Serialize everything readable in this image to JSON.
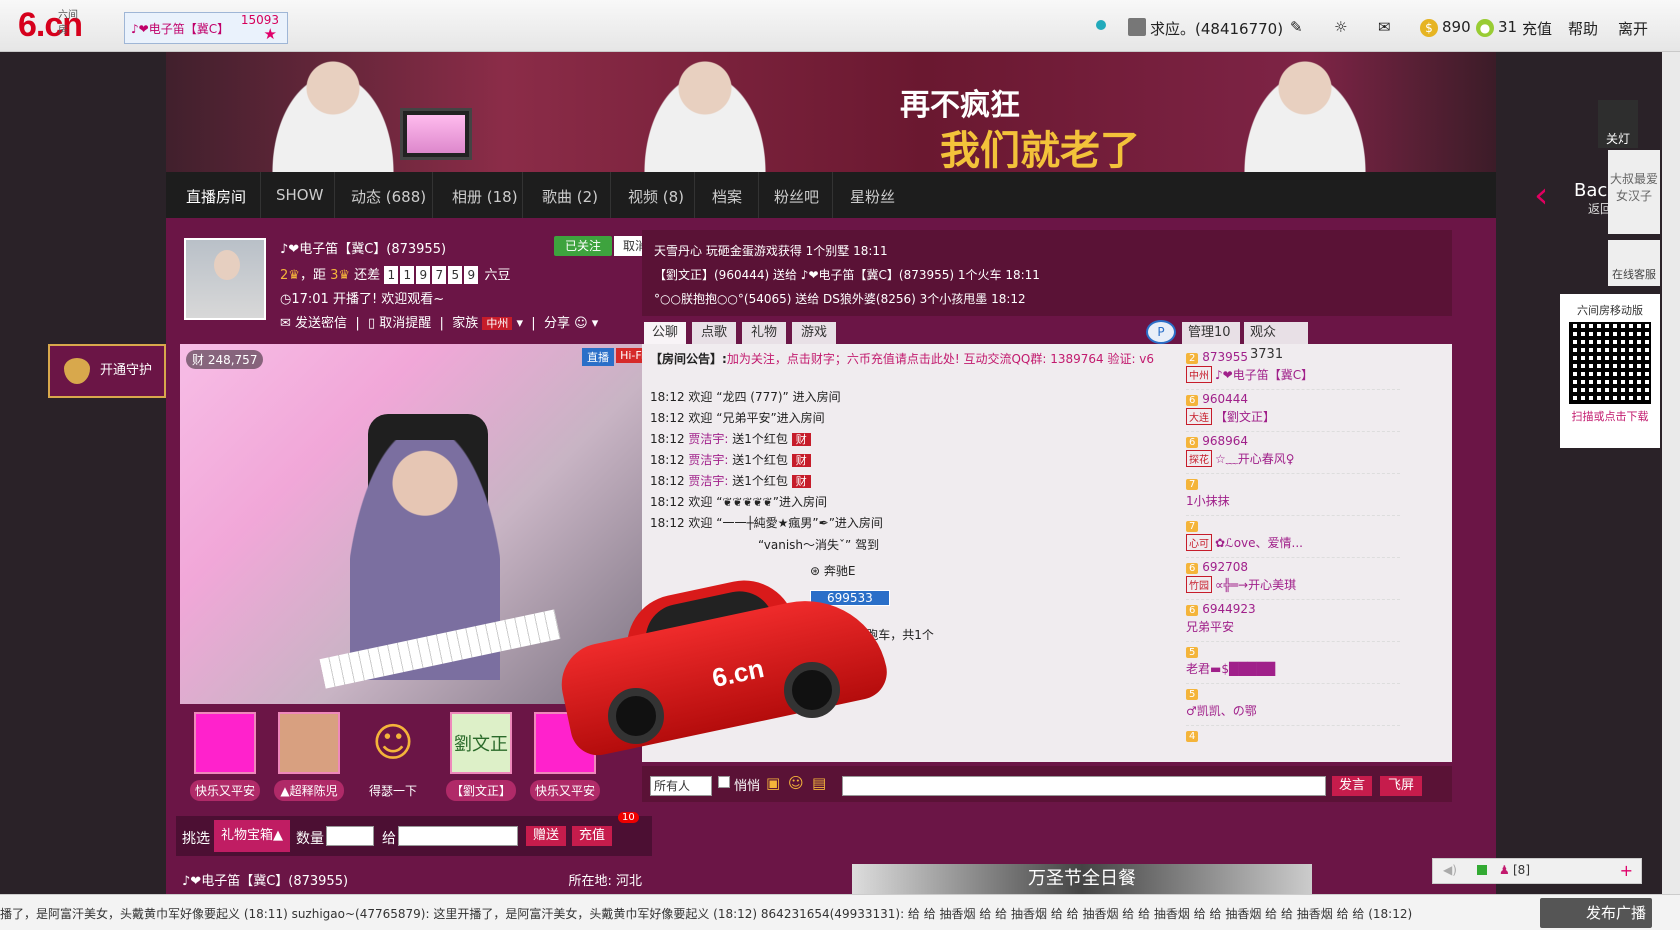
{
  "top": {
    "room_tab_label": "♪❤电子笛【冀C】",
    "room_tab_count": "15093",
    "user": "求应。(48416770)",
    "coins": "890",
    "beans": "31",
    "recharge": "充值",
    "help": "帮助",
    "leave": "离开"
  },
  "banner": {
    "slogan1": "再不疯狂",
    "slogan2": "我们就老了"
  },
  "nav": {
    "items": [
      "直播房间",
      "SHOW",
      "动态 (688)",
      "相册 (18)",
      "歌曲 (2)",
      "视频 (8)",
      "档案",
      "粉丝吧",
      "星粉丝"
    ],
    "back_label": "Back",
    "back_sub": "返回首页"
  },
  "host": {
    "name": "♪❤电子笛【冀C】(873955)",
    "follow": "已关注",
    "unfollow": "取消",
    "lv_text_a": "，距",
    "lv_text_b": "还差",
    "digits": [
      "1",
      "1",
      "9",
      "7",
      "5",
      "9"
    ],
    "lv_unit": "六豆",
    "msg": "17:01 开播了! 欢迎观看~",
    "op1": "发送密信",
    "op2": "取消提醒",
    "op3": "家族",
    "family_tag": "中州",
    "op4": "分享"
  },
  "video": {
    "fire_count": "248,757",
    "live": "直播",
    "hifi": "Hi-Fi"
  },
  "gifts": [
    {
      "label": "快乐又平安"
    },
    {
      "label": "▲超释陈児"
    },
    {
      "label": "得瑟一下"
    },
    {
      "label": "【劉文正】"
    },
    {
      "label": "快乐又平安"
    }
  ],
  "gift_image_text": "劉文正",
  "bottombar": {
    "pick": "挑选",
    "giftbox": "礼物宝箱▲",
    "qty": "数量",
    "to": "给",
    "send": "赠送",
    "recharge": "充值",
    "badge": "10"
  },
  "host_footer": {
    "name": "♪❤电子笛【冀C】(873955)",
    "loc": "所在地: 河北"
  },
  "notice": [
    "天雪丹心 玩砸金蛋游戏获得 1个别墅 18:11",
    "【劉文正】(960444) 送给 ♪❤电子笛【冀C】(873955) 1个火车 18:11",
    "°○○朕抱抱○○°(54065) 送给 DS狼外婆(8256) 3个小孩甩墨 18:12"
  ],
  "chat_tabs": [
    "公聊",
    "点歌",
    "礼物",
    "游戏"
  ],
  "user_tabs": [
    "管理10",
    "观众3731"
  ],
  "announcement": {
    "label": "【房间公告】:",
    "text": "加为关注，点击财字；六币充值请点击此处! 互动交流QQ群: 1389764 验证: v6"
  },
  "chat": [
    {
      "time": "18:12",
      "text": "欢迎 “龙四 (777)” 进入房间"
    },
    {
      "time": "18:12",
      "text": "欢迎 “兄弟平安”进入房间"
    },
    {
      "time": "18:12",
      "who": "贾洁宇:",
      "text": " 送1个红包"
    },
    {
      "time": "18:12",
      "who": "贾洁宇:",
      "text": " 送1个红包"
    },
    {
      "time": "18:12",
      "who": "贾洁宇:",
      "text": " 送1个红包"
    },
    {
      "time": "18:12",
      "text": "欢迎 “❦❦❦❦❦”进入房间"
    },
    {
      "time": "18:12",
      "text": "欢迎 “一一┼純愛★瘋男”✒”进入房间"
    },
    {
      "time": "",
      "text": "“vanish～消失ˇ” 驾到"
    },
    {
      "time": "",
      "text": "奔驰E"
    },
    {
      "time": "",
      "text": "699533"
    },
    {
      "time": "",
      "text": "C】送 跑车，共1个"
    }
  ],
  "users": [
    {
      "badge": "2",
      "id": "873955",
      "loc": "中州",
      "name": "♪❤电子笛【冀C】"
    },
    {
      "badge": "6",
      "id": "960444",
      "loc": "大连",
      "name": "【劉文正】"
    },
    {
      "badge": "6",
      "id": "968964",
      "loc": "探花",
      "name": "☆﹏开心春风♀"
    },
    {
      "badge": "7",
      "id": "",
      "loc": "",
      "name": "1小抹抹"
    },
    {
      "badge": "7",
      "id": "",
      "loc": "心可",
      "name": "✿ℒove、爱情..."
    },
    {
      "badge": "6",
      "id": "692708",
      "loc": "竹园",
      "name": "∝╬═→开心美琪"
    },
    {
      "badge": "6",
      "id": "6944923",
      "loc": "",
      "name": "兄弟平安"
    },
    {
      "badge": "5",
      "id": "",
      "loc": "",
      "name": "老君▬$█████"
    },
    {
      "badge": "5",
      "id": "",
      "loc": "",
      "name": "♂凯凯、の鄂"
    },
    {
      "badge": "4",
      "id": "",
      "loc": "",
      "name": ""
    }
  ],
  "input": {
    "to": "所有人",
    "whisper": "悄悄",
    "speak": "发言",
    "fly": "飞屏"
  },
  "side": {
    "guard": "开通守护",
    "lamp": "关灯",
    "ad": "大叔最爱 女汉子",
    "kf": "在线客服",
    "qr_title": "六间房移动版",
    "qr_sub": "扫描或点击下载"
  },
  "mini": {
    "count": "[8]"
  },
  "adstrip": "万圣节全日餐",
  "ticker": "播了，是阿富汗美女，头戴黄巾军好像要起义 (18:11)  suzhigao~(47765879): 这里开播了，是阿富汗美女，头戴黄巾军好像要起义 (18:12)  864231654(49933131): 给 给 抽香烟 给 给 抽香烟 给 给 抽香烟 给 给 抽香烟 给 给 抽香烟 给 给 抽香烟 给 给 (18:12)",
  "broadcast": "发布广播",
  "colors": {
    "accent": "#6b1546",
    "brand": "#d6001c"
  }
}
